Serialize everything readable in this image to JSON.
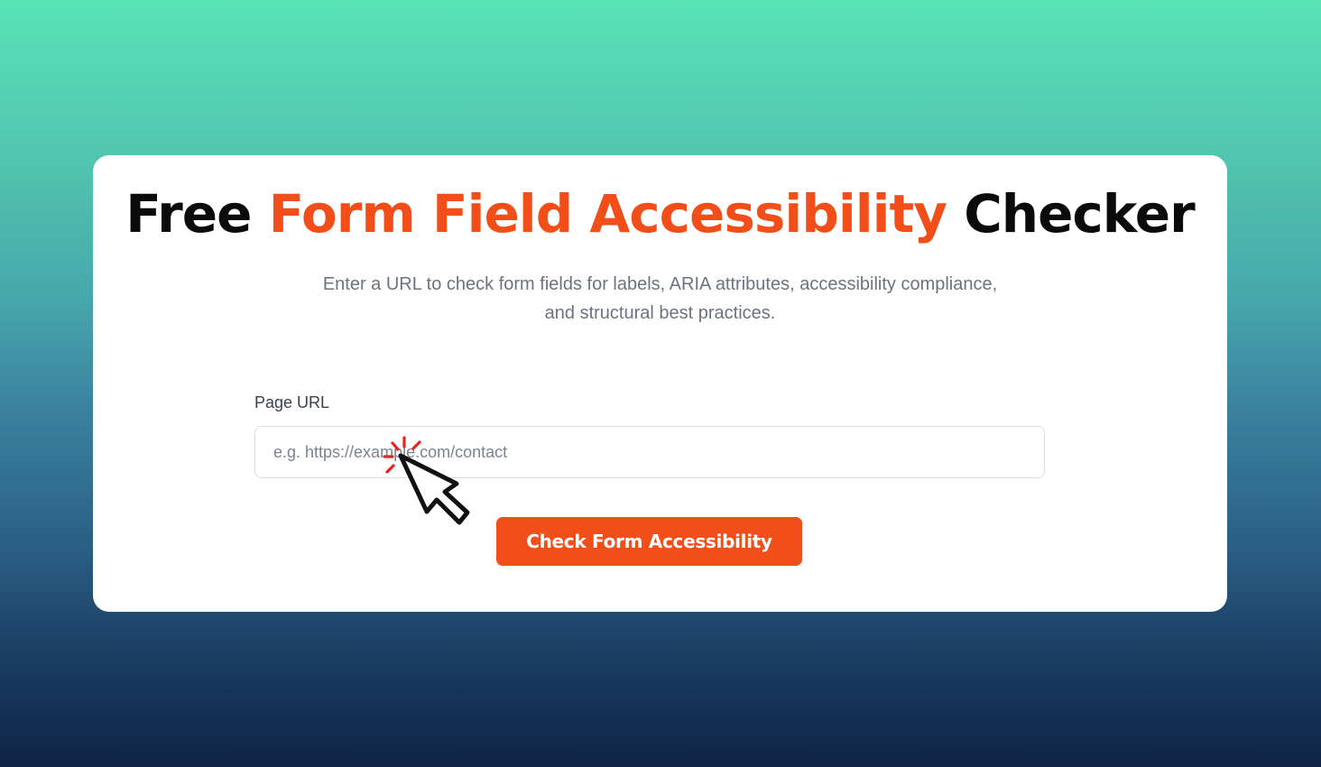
{
  "header": {
    "title_before": "Free ",
    "title_accent": "Form Field Accessibility",
    "title_after": " Checker",
    "subtitle": "Enter a URL to check form fields for labels, ARIA attributes, accessibility compliance, and structural best practices."
  },
  "form": {
    "url_label": "Page URL",
    "url_value": "",
    "url_placeholder": "e.g. https://example.com/contact",
    "submit_label": "Check Form Accessibility"
  },
  "overlay": {
    "icon": "pointer-cursor-click-icon"
  },
  "colors": {
    "accent": "#f24e1a",
    "title_text": "#0b0b0b",
    "muted_text": "#6b7280",
    "card_background": "#ffffff",
    "background_top": "#59e3b5",
    "background_bottom": "#0f2445"
  }
}
